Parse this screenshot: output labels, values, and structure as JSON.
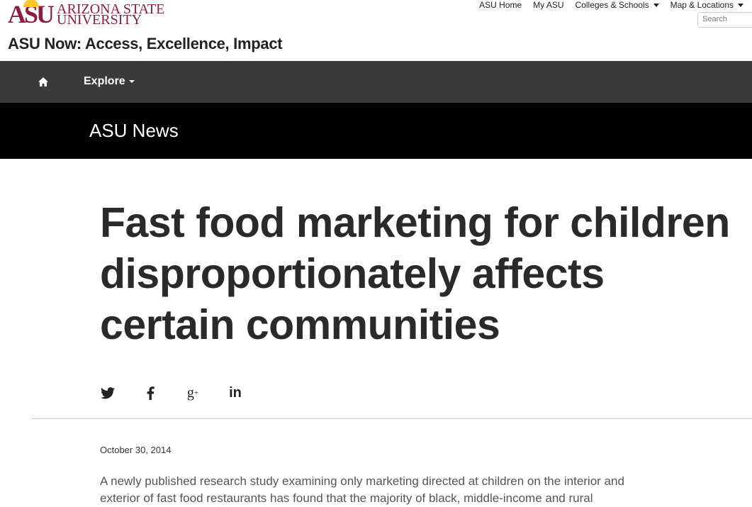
{
  "header": {
    "logo_mark": "ASU",
    "logo_line1": "ARIZONA STATE",
    "logo_line2": "UNIVERSITY",
    "site_title": "ASU Now: Access, Excellence, Impact",
    "utility_links": [
      "ASU Home",
      "My ASU",
      "Colleges & Schools",
      "Map & Locations"
    ],
    "search_placeholder": "Search"
  },
  "nav": {
    "home_icon": "home-icon",
    "explore_label": "Explore"
  },
  "section": {
    "title": "ASU News"
  },
  "article": {
    "headline": "Fast food marketing for children disproportionately affects certain communities",
    "share_icons": [
      "twitter-icon",
      "facebook-icon",
      "google-plus-icon",
      "linkedin-icon"
    ],
    "date": "October 30, 2014",
    "body": "A newly published research study examining only marketing directed at children on the interior and exterior of fast food restaurants has found that the majority of black, middle-income and rural"
  },
  "colors": {
    "brand_maroon": "#8c1d40",
    "brand_gold": "#ffc627",
    "nav_bg": "#3a3a3a",
    "section_bg": "#000000"
  }
}
